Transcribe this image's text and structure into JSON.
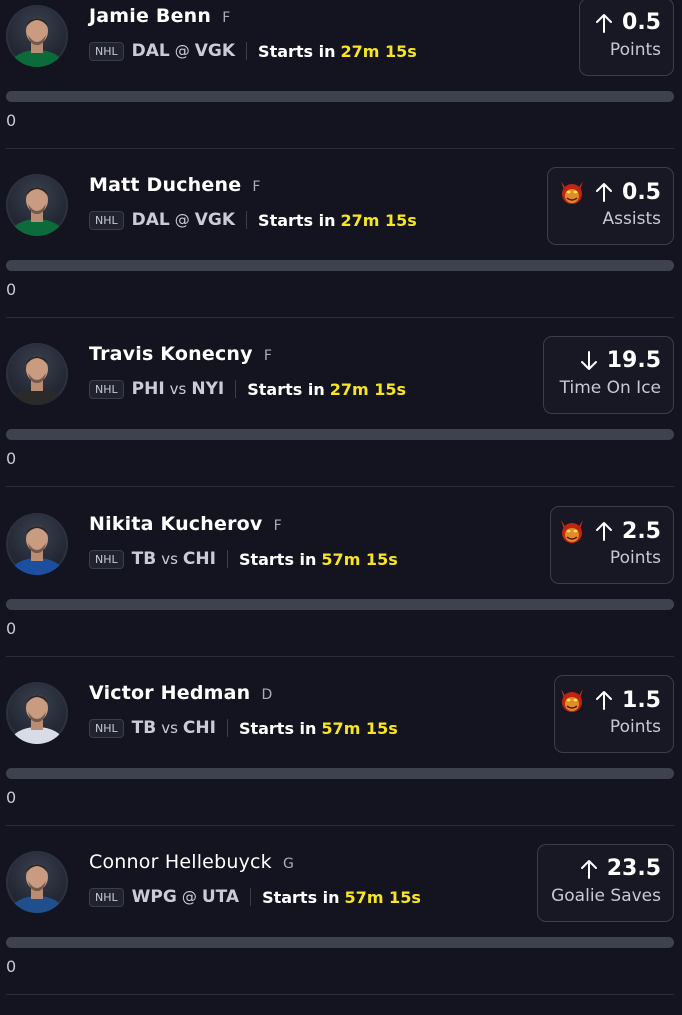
{
  "players": [
    {
      "name": "Jamie Benn",
      "name_bold": true,
      "position": "F",
      "league": "NHL",
      "team": "DAL",
      "matchup_sep": "@",
      "opponent": "VGK",
      "starts_label": "Starts in",
      "countdown": "27m 15s",
      "direction": "up",
      "demon": false,
      "line": "0.5",
      "stat": "Points",
      "progress": 0,
      "progress_value": "0",
      "jersey_color": "#0b6b3a"
    },
    {
      "name": "Matt Duchene",
      "name_bold": true,
      "position": "F",
      "league": "NHL",
      "team": "DAL",
      "matchup_sep": "@",
      "opponent": "VGK",
      "starts_label": "Starts in",
      "countdown": "27m 15s",
      "direction": "up",
      "demon": true,
      "line": "0.5",
      "stat": "Assists",
      "progress": 0,
      "progress_value": "0",
      "jersey_color": "#0b6b3a"
    },
    {
      "name": "Travis Konecny",
      "name_bold": true,
      "position": "F",
      "league": "NHL",
      "team": "PHI",
      "matchup_sep": "vs",
      "opponent": "NYI",
      "starts_label": "Starts in",
      "countdown": "27m 15s",
      "direction": "down",
      "demon": false,
      "line": "19.5",
      "stat": "Time On Ice",
      "progress": 0,
      "progress_value": "0",
      "jersey_color": "#2a2a2a"
    },
    {
      "name": "Nikita Kucherov",
      "name_bold": true,
      "position": "F",
      "league": "NHL",
      "team": "TB",
      "matchup_sep": "vs",
      "opponent": "CHI",
      "starts_label": "Starts in",
      "countdown": "57m 15s",
      "direction": "up",
      "demon": true,
      "line": "2.5",
      "stat": "Points",
      "progress": 0,
      "progress_value": "0",
      "jersey_color": "#1c4fa0"
    },
    {
      "name": "Victor Hedman",
      "name_bold": true,
      "position": "D",
      "league": "NHL",
      "team": "TB",
      "matchup_sep": "vs",
      "opponent": "CHI",
      "starts_label": "Starts in",
      "countdown": "57m 15s",
      "direction": "up",
      "demon": true,
      "line": "1.5",
      "stat": "Points",
      "progress": 0,
      "progress_value": "0",
      "jersey_color": "#d8dce6"
    },
    {
      "name": "Connor Hellebuyck",
      "name_bold": false,
      "position": "G",
      "league": "NHL",
      "team": "WPG",
      "matchup_sep": "@",
      "opponent": "UTA",
      "starts_label": "Starts in",
      "countdown": "57m 15s",
      "direction": "up",
      "demon": false,
      "line": "23.5",
      "stat": "Goalie Saves",
      "progress": 0,
      "progress_value": "0",
      "jersey_color": "#1f4f8c"
    }
  ],
  "colors": {
    "background": "#141420",
    "countdown": "#f7e51f",
    "progress_track": "#3e414e",
    "card_border": "#3a3d4c"
  },
  "icons": {
    "avatar": "player-headshot",
    "sport": "hockey-stick-icon",
    "up": "arrow-up-icon",
    "down": "arrow-down-icon",
    "demon": "demon-icon"
  }
}
